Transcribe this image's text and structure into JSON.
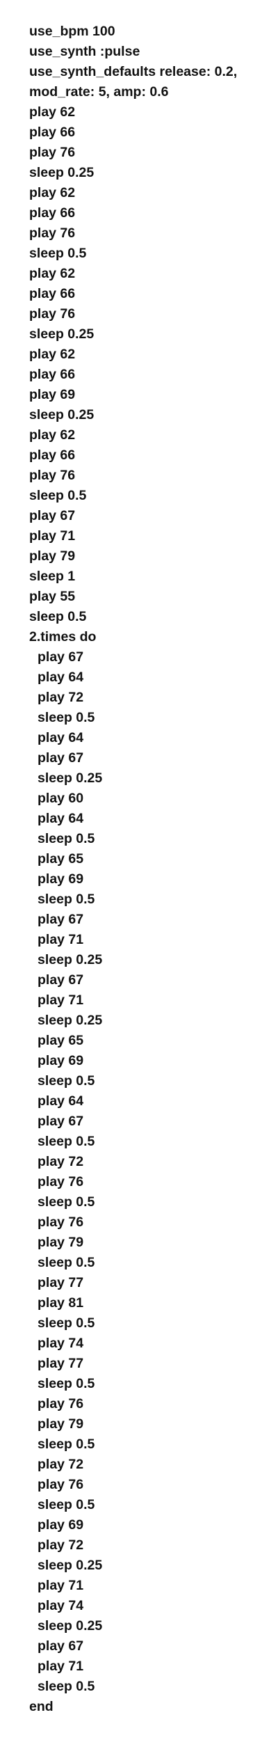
{
  "code_lines": [
    {
      "text": "use_bpm 100",
      "indent": 0
    },
    {
      "text": "use_synth :pulse",
      "indent": 0
    },
    {
      "text": "use_synth_defaults release: 0.2,",
      "indent": 0
    },
    {
      "text": "mod_rate: 5, amp: 0.6",
      "indent": 0
    },
    {
      "text": "play 62",
      "indent": 0
    },
    {
      "text": "play 66",
      "indent": 0
    },
    {
      "text": "play 76",
      "indent": 0
    },
    {
      "text": "sleep 0.25",
      "indent": 0
    },
    {
      "text": "play 62",
      "indent": 0
    },
    {
      "text": "play 66",
      "indent": 0
    },
    {
      "text": "play 76",
      "indent": 0
    },
    {
      "text": "sleep 0.5",
      "indent": 0
    },
    {
      "text": "play 62",
      "indent": 0
    },
    {
      "text": "play 66",
      "indent": 0
    },
    {
      "text": "play 76",
      "indent": 0
    },
    {
      "text": "sleep 0.25",
      "indent": 0
    },
    {
      "text": "play 62",
      "indent": 0
    },
    {
      "text": "play 66",
      "indent": 0
    },
    {
      "text": "play 69",
      "indent": 0
    },
    {
      "text": "sleep 0.25",
      "indent": 0
    },
    {
      "text": "play 62",
      "indent": 0
    },
    {
      "text": "play 66",
      "indent": 0
    },
    {
      "text": "play 76",
      "indent": 0
    },
    {
      "text": "sleep 0.5",
      "indent": 0
    },
    {
      "text": "play 67",
      "indent": 0
    },
    {
      "text": "play 71",
      "indent": 0
    },
    {
      "text": "play 79",
      "indent": 0
    },
    {
      "text": "sleep 1",
      "indent": 0
    },
    {
      "text": "play 55",
      "indent": 0
    },
    {
      "text": "sleep 0.5",
      "indent": 0
    },
    {
      "text": "2.times do",
      "indent": 0
    },
    {
      "text": "play 67",
      "indent": 1
    },
    {
      "text": "play 64",
      "indent": 1
    },
    {
      "text": "play 72",
      "indent": 1
    },
    {
      "text": "sleep 0.5",
      "indent": 1
    },
    {
      "text": "play 64",
      "indent": 1
    },
    {
      "text": "play 67",
      "indent": 1
    },
    {
      "text": "sleep 0.25",
      "indent": 1
    },
    {
      "text": "play 60",
      "indent": 1
    },
    {
      "text": "play 64",
      "indent": 1
    },
    {
      "text": "sleep 0.5",
      "indent": 1
    },
    {
      "text": "play 65",
      "indent": 1
    },
    {
      "text": "play 69",
      "indent": 1
    },
    {
      "text": "sleep 0.5",
      "indent": 1
    },
    {
      "text": "play 67",
      "indent": 1
    },
    {
      "text": "play 71",
      "indent": 1
    },
    {
      "text": "sleep 0.25",
      "indent": 1
    },
    {
      "text": "play 67",
      "indent": 1
    },
    {
      "text": "play 71",
      "indent": 1
    },
    {
      "text": "sleep 0.25",
      "indent": 1
    },
    {
      "text": "play 65",
      "indent": 1
    },
    {
      "text": "play 69",
      "indent": 1
    },
    {
      "text": "sleep 0.5",
      "indent": 1
    },
    {
      "text": "play 64",
      "indent": 1
    },
    {
      "text": "play 67",
      "indent": 1
    },
    {
      "text": "sleep 0.5",
      "indent": 1
    },
    {
      "text": "play 72",
      "indent": 1
    },
    {
      "text": "play 76",
      "indent": 1
    },
    {
      "text": "sleep 0.5",
      "indent": 1
    },
    {
      "text": "play 76",
      "indent": 1
    },
    {
      "text": "play 79",
      "indent": 1
    },
    {
      "text": "sleep 0.5",
      "indent": 1
    },
    {
      "text": "play 77",
      "indent": 1
    },
    {
      "text": "play 81",
      "indent": 1
    },
    {
      "text": "sleep 0.5",
      "indent": 1
    },
    {
      "text": "play 74",
      "indent": 1
    },
    {
      "text": "play 77",
      "indent": 1
    },
    {
      "text": "sleep 0.5",
      "indent": 1
    },
    {
      "text": "play 76",
      "indent": 1
    },
    {
      "text": "play 79",
      "indent": 1
    },
    {
      "text": "sleep 0.5",
      "indent": 1
    },
    {
      "text": "play 72",
      "indent": 1
    },
    {
      "text": "play 76",
      "indent": 1
    },
    {
      "text": "sleep 0.5",
      "indent": 1
    },
    {
      "text": "play 69",
      "indent": 1
    },
    {
      "text": "play 72",
      "indent": 1
    },
    {
      "text": "sleep 0.25",
      "indent": 1
    },
    {
      "text": "play 71",
      "indent": 1
    },
    {
      "text": "play 74",
      "indent": 1
    },
    {
      "text": "sleep 0.25",
      "indent": 1
    },
    {
      "text": "play 67",
      "indent": 1
    },
    {
      "text": "play 71",
      "indent": 1
    },
    {
      "text": "sleep 0.5",
      "indent": 1
    },
    {
      "text": "end",
      "indent": 0
    }
  ]
}
